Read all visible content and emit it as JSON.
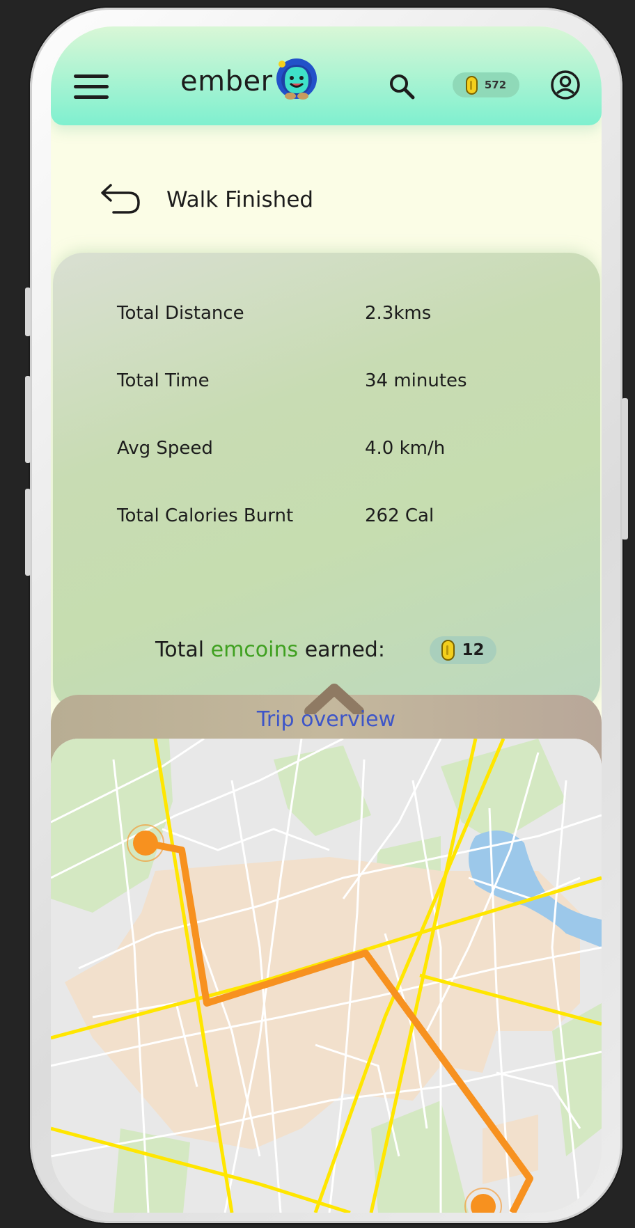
{
  "header": {
    "brand": "ember",
    "coin_balance": "572"
  },
  "page": {
    "title": "Walk Finished"
  },
  "stats": [
    {
      "label": "Total Distance",
      "value": "2.3kms"
    },
    {
      "label": "Total Time",
      "value": "34 minutes"
    },
    {
      "label": "Avg Speed",
      "value": "4.0 km/h"
    },
    {
      "label": "Total Calories Burnt",
      "value": "262 Cal"
    }
  ],
  "earned": {
    "prefix": "Total",
    "highlight": "emcoins",
    "suffix": "earned:",
    "amount": "12"
  },
  "trip": {
    "title": "Trip overview"
  },
  "colors": {
    "header_top": "#d9f7d6",
    "header_bottom": "#7ff0cf",
    "emcoins_green": "#3fa020",
    "trip_title_blue": "#3d55c8",
    "route_orange": "#f7911f",
    "road_yellow": "#ffe600"
  },
  "icons": [
    "menu-icon",
    "logo-icon",
    "search-icon",
    "coin-icon",
    "profile-icon",
    "back-arrow-icon",
    "chevron-up-icon",
    "map-pin-icon"
  ]
}
